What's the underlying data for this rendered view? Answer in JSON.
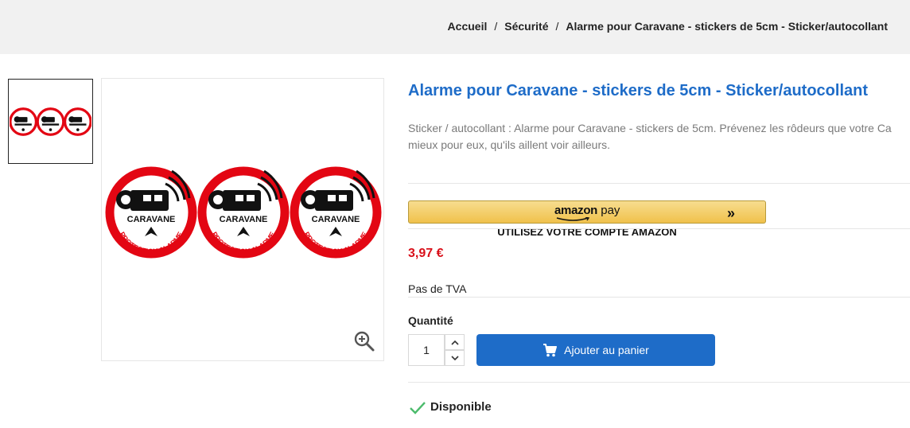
{
  "breadcrumb": {
    "items": [
      "Accueil",
      "Sécurité",
      "Alarme pour Caravane - stickers de 5cm - Sticker/autocollant"
    ],
    "separator": "/"
  },
  "product": {
    "title": "Alarme pour Caravane - stickers de 5cm - Sticker/autocollant",
    "description_lines": [
      "Sticker / autocollant : Alarme pour Caravane -  stickers de 5cm. Prévenez les rôdeurs que votre Ca",
      "mieux pour eux, qu'ils aillent voir ailleurs."
    ],
    "sticker_text": {
      "vehicle": "CARAVANE",
      "band": "PROTECTION ALARME"
    },
    "price": "3,97 €",
    "tax_note": "Pas de TVA"
  },
  "amazon_pay": {
    "logo_word_1": "amazon",
    "logo_word_2": "pay",
    "chevron": "»",
    "caption": "UTILISEZ VOTRE COMPTE AMAZON"
  },
  "quantity": {
    "label": "Quantité",
    "value": "1"
  },
  "cart": {
    "button_label": "Ajouter au panier"
  },
  "availability": {
    "label": "Disponible"
  },
  "colors": {
    "accent_blue": "#1e6cc8",
    "price_red": "#d9101a",
    "sticker_red": "#e30613",
    "available_green": "#4cbb6c",
    "amazon_gold": "#f0c14b"
  },
  "icons": [
    "zoom-in-icon",
    "cart-icon",
    "chevron-up-icon",
    "chevron-down-icon",
    "check-icon",
    "double-chevron-right-icon"
  ]
}
